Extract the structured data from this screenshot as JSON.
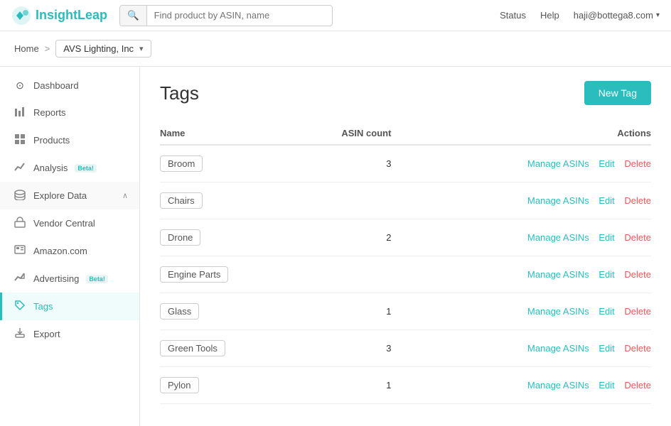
{
  "header": {
    "logo_text": "InsightLeap",
    "search_placeholder": "Find product by ASIN, name",
    "status_label": "Status",
    "help_label": "Help",
    "user_email": "haji@bottega8.com"
  },
  "breadcrumb": {
    "home": "Home",
    "separator": ">",
    "company": "AVS Lighting, Inc"
  },
  "sidebar": {
    "items": [
      {
        "id": "dashboard",
        "label": "Dashboard",
        "icon": "⊙",
        "active": false
      },
      {
        "id": "reports",
        "label": "Reports",
        "icon": "📊",
        "active": false
      },
      {
        "id": "products",
        "label": "Products",
        "icon": "⊞",
        "active": false
      },
      {
        "id": "analysis",
        "label": "Analysis",
        "icon": "📈",
        "beta": true,
        "active": false
      },
      {
        "id": "explore-data",
        "label": "Explore Data",
        "icon": "🗄",
        "active": false,
        "expandable": true,
        "expanded": true
      },
      {
        "id": "vendor-central",
        "label": "Vendor Central",
        "icon": "🏪",
        "active": false
      },
      {
        "id": "amazon",
        "label": "Amazon.com",
        "icon": "🧾",
        "active": false
      },
      {
        "id": "advertising",
        "label": "Advertising",
        "icon": "📉",
        "beta": true,
        "active": false
      },
      {
        "id": "tags",
        "label": "Tags",
        "icon": "🏷",
        "active": true
      },
      {
        "id": "export",
        "label": "Export",
        "icon": "📤",
        "active": false
      }
    ]
  },
  "content": {
    "title": "Tags",
    "new_tag_button": "New Tag",
    "table": {
      "columns": [
        {
          "id": "name",
          "label": "Name"
        },
        {
          "id": "asin_count",
          "label": "ASIN count"
        },
        {
          "id": "actions",
          "label": "Actions"
        }
      ],
      "rows": [
        {
          "name": "Broom",
          "asin_count": "3",
          "manage_label": "Manage ASINs",
          "edit_label": "Edit",
          "delete_label": "Delete"
        },
        {
          "name": "Chairs",
          "asin_count": "",
          "manage_label": "Manage ASINs",
          "edit_label": "Edit",
          "delete_label": "Delete"
        },
        {
          "name": "Drone",
          "asin_count": "2",
          "manage_label": "Manage ASINs",
          "edit_label": "Edit",
          "delete_label": "Delete"
        },
        {
          "name": "Engine Parts",
          "asin_count": "",
          "manage_label": "Manage ASINs",
          "edit_label": "Edit",
          "delete_label": "Delete"
        },
        {
          "name": "Glass",
          "asin_count": "1",
          "manage_label": "Manage ASINs",
          "edit_label": "Edit",
          "delete_label": "Delete"
        },
        {
          "name": "Green Tools",
          "asin_count": "3",
          "manage_label": "Manage ASINs",
          "edit_label": "Edit",
          "delete_label": "Delete"
        },
        {
          "name": "Pylon",
          "asin_count": "1",
          "manage_label": "Manage ASINs",
          "edit_label": "Edit",
          "delete_label": "Delete"
        }
      ]
    }
  }
}
